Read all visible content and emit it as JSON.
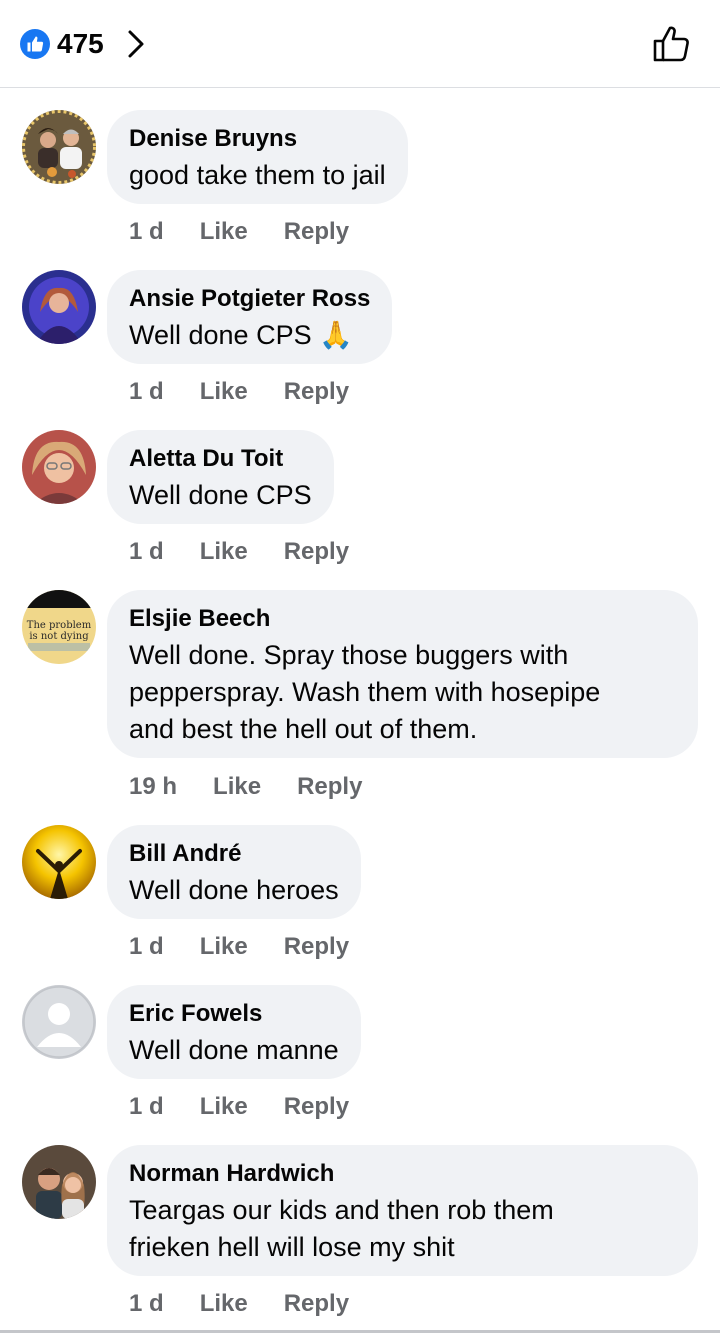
{
  "header": {
    "reaction_count": "475",
    "reaction_icon": "thumbs-up-reaction-icon",
    "accent": "#1877f2"
  },
  "comments": [
    {
      "name": "Denise Bruyns",
      "lines": [
        "good take them to jail"
      ],
      "time": "1 d",
      "like": "Like",
      "reply": "Reply",
      "avatar": "avatar-couple-photo"
    },
    {
      "name": "Ansie Potgieter Ross",
      "lines": [
        "Well done CPS 🙏"
      ],
      "time": "1 d",
      "like": "Like",
      "reply": "Reply",
      "avatar": "avatar-woman-blue-photo"
    },
    {
      "name": "Aletta Du Toit",
      "lines": [
        "Well done CPS"
      ],
      "time": "1 d",
      "like": "Like",
      "reply": "Reply",
      "avatar": "avatar-woman-glasses-photo"
    },
    {
      "name": "Elsjie Beech",
      "lines": [
        "Well done. Spray those buggers with",
        "pepperspray. Wash them with hosepipe",
        "and best the hell out of them."
      ],
      "time": "19 h",
      "like": "Like",
      "reply": "Reply",
      "avatar": "avatar-text-quote",
      "avatar_text": [
        "The problem",
        "is not dying"
      ]
    },
    {
      "name": "Bill André",
      "lines": [
        "Well done heroes"
      ],
      "time": "1 d",
      "like": "Like",
      "reply": "Reply",
      "avatar": "avatar-sunrise-photo"
    },
    {
      "name": "Eric Fowels",
      "lines": [
        "Well done manne"
      ],
      "time": "1 d",
      "like": "Like",
      "reply": "Reply",
      "avatar": "avatar-default-silhouette"
    },
    {
      "name": "Norman Hardwich",
      "lines": [
        "Teargas our kids and then rob them",
        "frieken hell will lose my shit"
      ],
      "time": "1 d",
      "like": "Like",
      "reply": "Reply",
      "avatar": "avatar-selfie-photo"
    }
  ]
}
